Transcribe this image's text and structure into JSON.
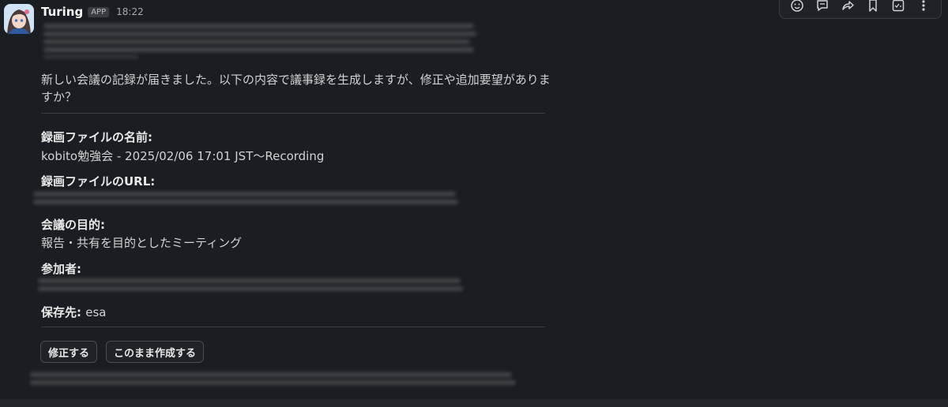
{
  "message": {
    "sender": "Turing",
    "badge": "APP",
    "time": "18:22",
    "intro": "新しい会議の記録が届きました。以下の内容で議事録を生成しますが、修正や追加要望がありますか？",
    "fields": {
      "file_name_label": "録画ファイルの名前:",
      "file_name_value": "kobito勉強会 - 2025/02/06 17:01 JST〜Recording",
      "file_url_label": "録画ファイルのURL:",
      "purpose_label": "会議の目的:",
      "purpose_value": "報告・共有を目的としたミーティング",
      "participants_label": "参加者:",
      "destination_label": "保存先:",
      "destination_value": "esa"
    },
    "buttons": {
      "edit": "修正する",
      "create": "このまま作成する"
    }
  },
  "toolbar": {
    "icons": [
      "emoji-reaction-icon",
      "reply-thread-icon",
      "forward-icon",
      "bookmark-icon",
      "checklist-icon",
      "more-actions-icon"
    ]
  },
  "colors": {
    "background": "#1a1d21",
    "text": "#d1d2d3",
    "muted": "#a8a9ab",
    "border": "#3a3c40"
  }
}
